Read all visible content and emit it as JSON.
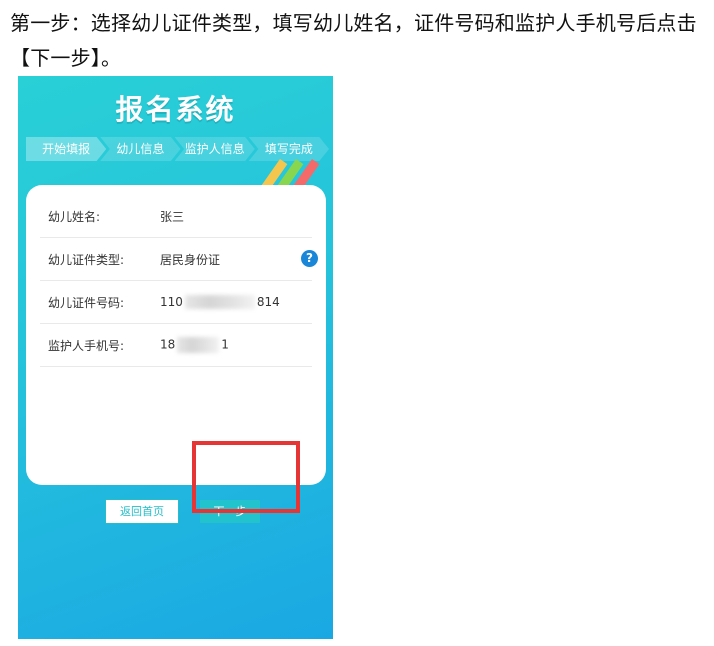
{
  "instruction": {
    "line1": "第一步：选择幼儿证件类型，填写幼儿姓名，证件号码和监护人手机号后点击",
    "line2": "【下一步】。"
  },
  "app": {
    "title": "报名系统",
    "steps": [
      "开始填报",
      "幼儿信息",
      "监护人信息",
      "填写完成"
    ],
    "form": {
      "child_name_label": "幼儿姓名:",
      "child_name_value": "张三",
      "id_type_label": "幼儿证件类型:",
      "id_type_value": "居民身份证",
      "id_number_label": "幼儿证件号码:",
      "id_number_prefix": "110",
      "id_number_suffix": "814",
      "guardian_phone_label": "监护人手机号:",
      "guardian_phone_prefix": "18",
      "guardian_phone_suffix": "1"
    },
    "buttons": {
      "back": "返回首页",
      "next": "下一步"
    },
    "help_icon": "?"
  }
}
